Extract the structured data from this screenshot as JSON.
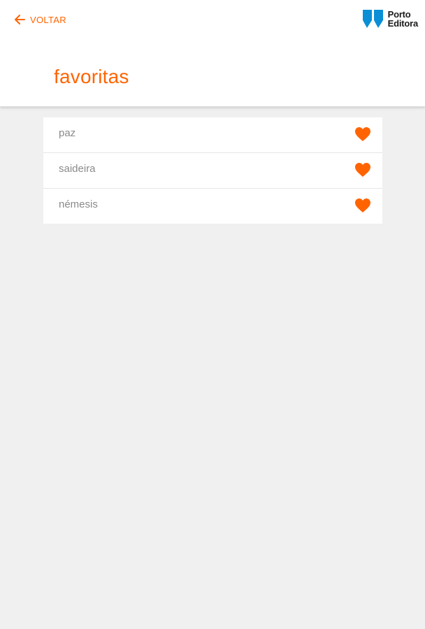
{
  "header": {
    "back_label": "VOLTAR",
    "back_icon": "arrow-left-icon",
    "logo": {
      "line1": "Porto",
      "line2": "Editora",
      "icon": "porto-editora-logo-icon"
    },
    "title": "favoritas"
  },
  "favorites": {
    "items": [
      {
        "word": "paz",
        "icon": "heart-icon"
      },
      {
        "word": "saideira",
        "icon": "heart-icon"
      },
      {
        "word": "némesis",
        "icon": "heart-icon"
      }
    ]
  },
  "colors": {
    "accent": "#ff6400",
    "logo_blue": "#0a8fd6",
    "background": "#f0f0f0",
    "card": "#ffffff",
    "word_text": "#8a8a8a"
  }
}
